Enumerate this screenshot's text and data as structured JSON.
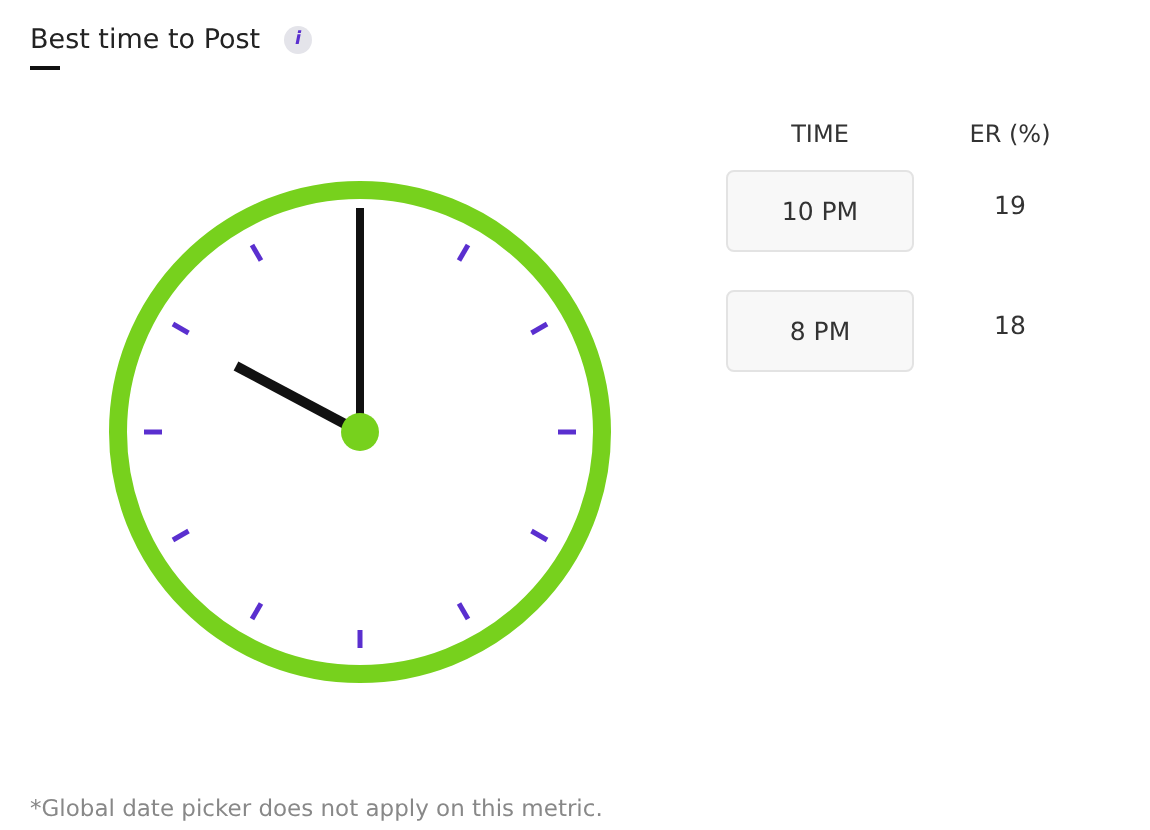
{
  "title": "Best time to Post",
  "info_icon": "i",
  "table": {
    "columns": [
      "TIME",
      "ER (%)"
    ],
    "rows": [
      {
        "time": "10 PM",
        "er": "19"
      },
      {
        "time": "8 PM",
        "er": "18"
      }
    ]
  },
  "footnote": "*Global date picker does not apply on this metric."
}
